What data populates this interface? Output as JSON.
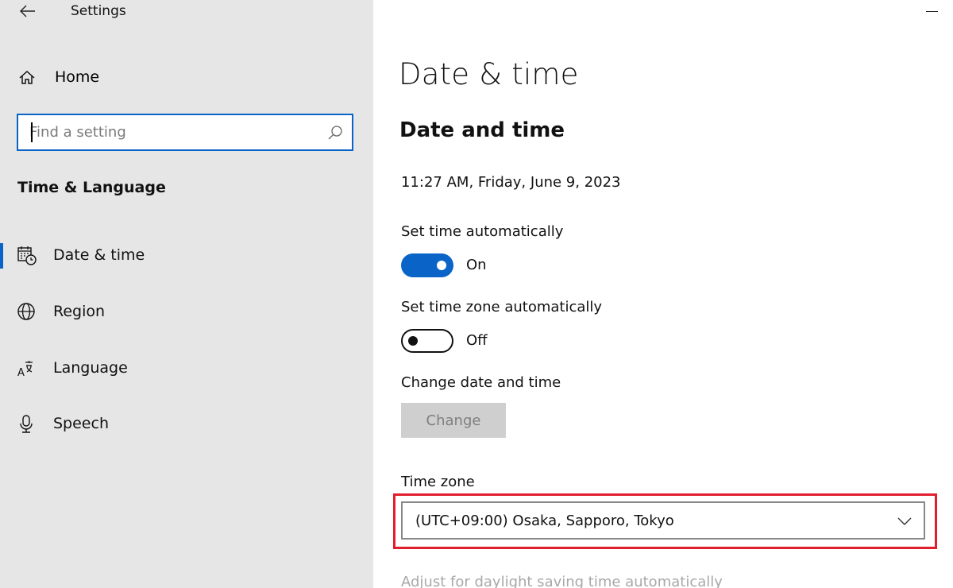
{
  "window": {
    "title": "Settings"
  },
  "sidebar": {
    "home_label": "Home",
    "search_placeholder": "Find a setting",
    "section_label": "Time & Language",
    "items": [
      {
        "label": "Date & time",
        "icon": "calendar-clock-icon",
        "active": true
      },
      {
        "label": "Region",
        "icon": "globe-icon",
        "active": false
      },
      {
        "label": "Language",
        "icon": "language-icon",
        "active": false
      },
      {
        "label": "Speech",
        "icon": "microphone-icon",
        "active": false
      }
    ]
  },
  "main": {
    "page_title": "Date & time",
    "section_title": "Date and time",
    "current_datetime": "11:27 AM, Friday, June 9, 2023",
    "set_time_auto": {
      "label": "Set time automatically",
      "state": "On"
    },
    "set_tz_auto": {
      "label": "Set time zone automatically",
      "state": "Off"
    },
    "change_date": {
      "label": "Change date and time",
      "button": "Change"
    },
    "time_zone": {
      "label": "Time zone",
      "value": "(UTC+09:00) Osaka, Sapporo, Tokyo"
    },
    "dst_label": "Adjust for daylight saving time automatically"
  },
  "colors": {
    "accent": "#0a64c8",
    "highlight": "#e01e2d",
    "sidebar_bg": "#e6e6e6"
  }
}
